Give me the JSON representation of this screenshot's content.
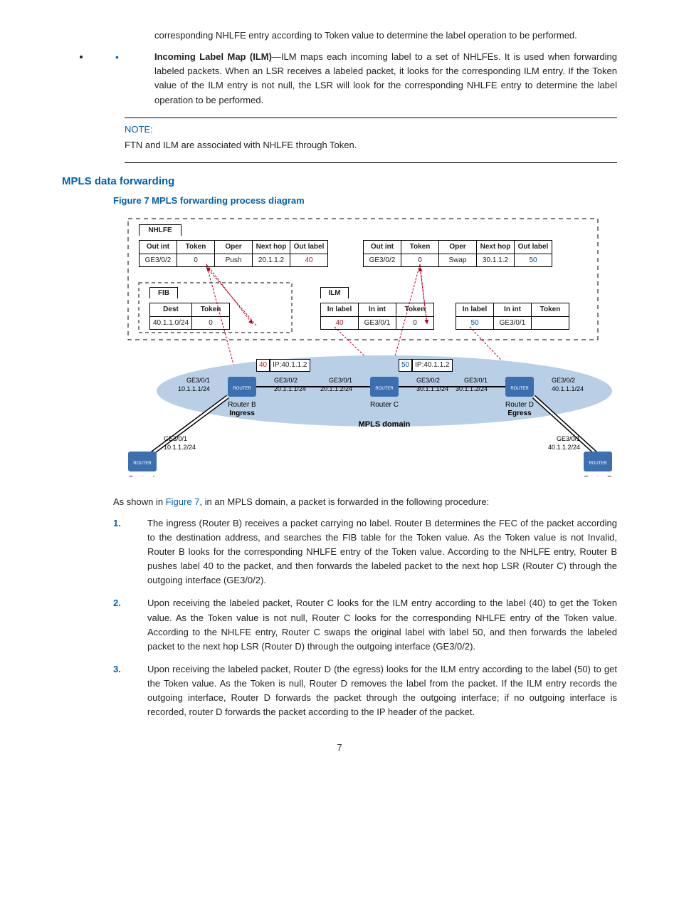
{
  "intro_continued": "corresponding NHLFE entry according to Token value to determine the label operation to be performed.",
  "bullet": {
    "term": "Incoming Label Map (ILM)",
    "body": "—ILM maps each incoming label to a set of NHLFEs. It is used when forwarding labeled packets. When an LSR receives a labeled packet, it looks for the corresponding ILM entry. If the Token value of the ILM entry is not null, the LSR will look for the corresponding NHLFE entry to determine the label operation to be performed."
  },
  "note": {
    "title": "NOTE:",
    "body": "FTN and ILM are associated with NHLFE through Token."
  },
  "section_heading": "MPLS data forwarding",
  "figure_caption": "Figure 7 MPLS forwarding process diagram",
  "diagram": {
    "nhlfe_title": "NHLFE",
    "nhlfe_headers": [
      "Out int",
      "Token",
      "Oper",
      "Next hop",
      "Out label"
    ],
    "nhlfe_row1": [
      "GE3/0/2",
      "0",
      "Push",
      "20.1.1.2",
      "40"
    ],
    "nhlfe_row2": [
      "GE3/0/2",
      "0",
      "Swap",
      "30.1.1.2",
      "50"
    ],
    "fib_title": "FIB",
    "fib_headers": [
      "Dest",
      "Token"
    ],
    "fib_row": [
      "40.1.1.0/24",
      "0"
    ],
    "ilm_title": "ILM",
    "ilm_headers": [
      "In label",
      "In int",
      "Token"
    ],
    "ilm_row1": [
      "40",
      "GE3/0/1",
      "0"
    ],
    "ilm_row2": [
      "50",
      "GE3/0/1",
      ""
    ],
    "pkt1_label": "40",
    "pkt1_ip": "IP:40.1.1.2",
    "pkt2_label": "50",
    "pkt2_ip": "IP:40.1.1.2",
    "routerA": "Router A",
    "routerB": "Router B",
    "routerC": "Router C",
    "routerD": "Router D",
    "routerE": "Router E",
    "ingress": "Ingress",
    "egress": "Egress",
    "mpls_domain": "MPLS domain",
    "if_ge301": "GE3/0/1",
    "if_ge302": "GE3/0/2",
    "addr_a": "10.1.1.2/24",
    "addr_b_l": "10.1.1.1/24",
    "addr_b_r": "20.1.1.1/24",
    "addr_c_l": "20.1.1.2/24",
    "addr_c_r": "30.1.1.1/24",
    "addr_d_l": "30.1.1.2/24",
    "addr_d_r": "40.1.1.1/24",
    "addr_e": "40.1.1.2/24",
    "router_word": "ROUTER"
  },
  "intro_after": {
    "pre": "As shown in ",
    "ref": "Figure 7",
    "post": ", in an MPLS domain, a packet is forwarded in the following procedure:"
  },
  "steps": [
    "The ingress (Router B) receives a packet carrying no label. Router B determines the FEC of the packet according to the destination address, and searches the FIB table for the Token value. As the Token value is not Invalid, Router B looks for the corresponding NHLFE entry of the Token value. According to the NHLFE entry, Router B pushes label 40 to the packet, and then forwards the labeled packet to the next hop LSR (Router C) through the outgoing interface (GE3/0/2).",
    "Upon receiving the labeled packet, Router C looks for the ILM entry according to the label (40) to get the Token value. As the Token value is not null, Router C looks for the corresponding NHLFE entry of the Token value. According to the NHLFE entry, Router C swaps the original label with label 50, and then forwards the labeled packet to the next hop LSR (Router D) through the outgoing interface (GE3/0/2).",
    "Upon receiving the labeled packet, Router D (the egress) looks for the ILM entry according to the label (50) to get the Token value. As the Token is null, Router D removes the label from the packet. If the ILM entry records the outgoing interface, Router D forwards the packet through the outgoing interface; if no outgoing interface is recorded, router D forwards the packet according to the IP header of the packet."
  ],
  "page_number": "7"
}
